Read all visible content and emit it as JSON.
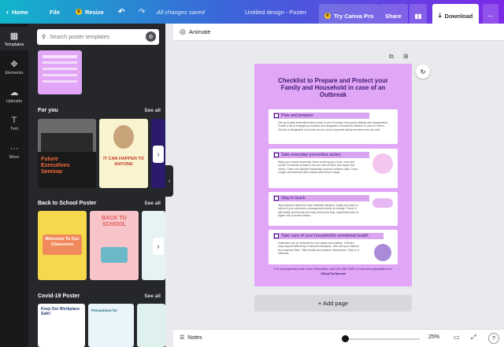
{
  "topbar": {
    "home": "Home",
    "file": "File",
    "resize": "Resize",
    "saved_status": "All changes saved",
    "doc_title": "Untitled design - Poster",
    "try_pro": "Try Canva Pro",
    "share": "Share",
    "download": "Download"
  },
  "rail": {
    "templates": "Templates",
    "elements": "Elements",
    "uploads": "Uploads",
    "text": "Text",
    "more": "More"
  },
  "panel": {
    "search_placeholder": "Search poster templates",
    "see_all": "See all",
    "sections": [
      {
        "title": "For you"
      },
      {
        "title": "Back to School Poster"
      },
      {
        "title": "Covid-19 Poster"
      }
    ],
    "thumbs": {
      "future_exec": "Future Executives Seminar",
      "it_can_happen": "IT CAN HAPPEN TO ANYONE",
      "welcome": "Welcome To Our Classroom",
      "back_school": "BACK TO SCHOOL",
      "keep_safe": "Keep Our Workplace Safe!",
      "precautions": "Precautions for"
    }
  },
  "canvas": {
    "animate": "Animate",
    "add_page": "+ Add page"
  },
  "poster": {
    "title": "Checklist to Prepare and Protect your Family and Household in case of an Outbreak",
    "cards": [
      {
        "heading": "Plan and prepare",
        "body": "Get up-to-date information about local Covid-19 activity from public officials and departments. Create a list of emergency contacts and designate a household member to care for others. Choose a designated room that can be used to separate family members who are sick."
      },
      {
        "heading": "Take everyday preventive action",
        "body": "Wash your hands frequently. Avoid touching your eyes, nose and mouth. Put family members who are sick at home and away from others. Clean and disinfect frequently touched surfaces daily. Cover coughs and sneezes with a tissue and throw it away."
      },
      {
        "heading": "Stay in touch",
        "body": "Stay informed about the local outbreak situation. Notify your work or school if your schedule or arrangement needs to change. Check in with family and friends who may need extra help, especially those at higher risk of severe illness."
      },
      {
        "heading": "Take care of your household's emotional health",
        "body": "Outbreaks can be stressful for both adults and children. Children may respond differently to stressful situations. Talk with your children and reassure them. Take breaks and practice mindfulness. Stick to a schedule."
      }
    ],
    "footer": "For emergencies and more information call 123-456-7890 or visit www.greatsite.com",
    "hashtag": "#StopTheSpread"
  },
  "footer": {
    "notes": "Notes",
    "zoom": "25%"
  }
}
